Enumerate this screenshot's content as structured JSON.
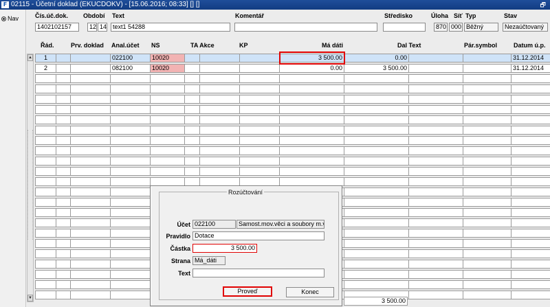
{
  "window": {
    "title": "02115 - Účetní doklad (EKUCDOKV) - [15.06.2016; 08:33] [] []",
    "restore_glyph": "🗗"
  },
  "nav": {
    "label": "Nav"
  },
  "header": {
    "labels": {
      "cis": "Čís.úč.dok.",
      "obdobi": "Období",
      "text": "Text",
      "komentar": "Komentář",
      "stredisko": "Středisko",
      "uloha": "Úloha",
      "sit": "Síť",
      "typ": "Typ",
      "stav": "Stav"
    },
    "values": {
      "cis": "1402102157",
      "obdobi_a": "12",
      "obdobi_b": "14",
      "text": "text1 54288",
      "komentar": "",
      "stredisko": "",
      "uloha": "870",
      "sit": "000",
      "typ": "Běžný",
      "stav": "Nezaúčtovaný"
    }
  },
  "table": {
    "columns": {
      "rad": "Řád.",
      "prv": "Prv. doklad",
      "anal": "Anal.účet",
      "ns": "NS",
      "ta": "TA Akce",
      "kp": "KP",
      "ma": "Má dáti",
      "dal": "Dal Text",
      "par": "Pár.symbol",
      "datum": "Datum ú.p."
    },
    "rows": [
      {
        "rad": "1",
        "anal": "022100",
        "ns": "10020",
        "ma": "3 500.00",
        "dal": "0.00",
        "datum": "31.12.2014"
      },
      {
        "rad": "2",
        "anal": "082100",
        "ns": "10020",
        "ma": "0.00",
        "dal": "3 500.00",
        "datum": "31.12.2014"
      }
    ],
    "total": "3 500.00"
  },
  "dialog": {
    "title": "Rozúčtování",
    "labels": {
      "ucet": "Účet",
      "pravidlo": "Pravidlo",
      "castka": "Částka",
      "strana": "Strana",
      "text": "Text"
    },
    "values": {
      "ucet": "022100",
      "ucet_name": "Samost.mov.věci a soubory m.v.",
      "pravidlo": "Dotace",
      "castka": "3 500.00",
      "strana": "Má_dáti",
      "text": ""
    },
    "buttons": {
      "proved": "Proveď",
      "konec": "Konec"
    }
  }
}
